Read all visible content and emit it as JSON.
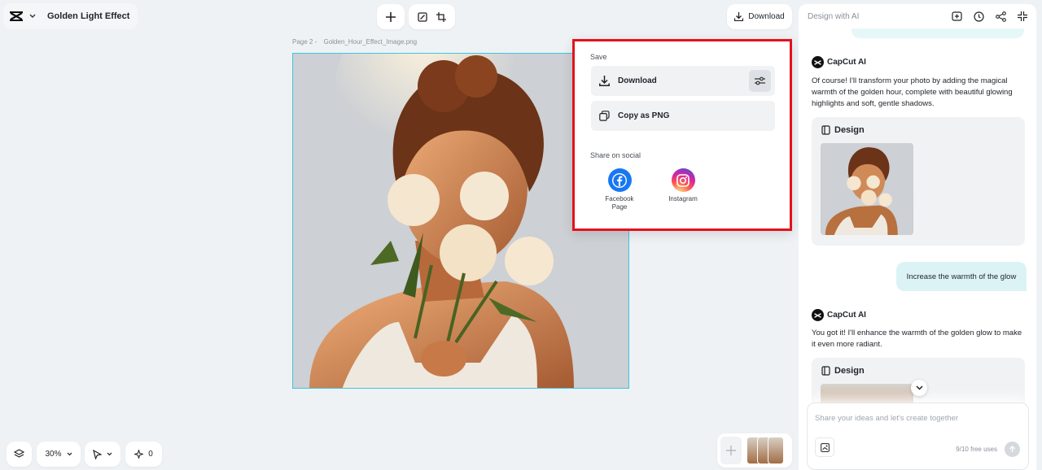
{
  "header": {
    "title": "Golden Light Effect",
    "download_label": "Download"
  },
  "canvas": {
    "page_label": "Page 2 -",
    "file_name": "Golden_Hour_Effect_Image.png"
  },
  "download_menu": {
    "save_heading": "Save",
    "download_label": "Download",
    "copy_label": "Copy as PNG",
    "share_heading": "Share on social",
    "social": [
      {
        "label_line1": "Facebook",
        "label_line2": "Page",
        "icon": "facebook-icon",
        "color": "#1877f2"
      },
      {
        "label_line1": "Instagram",
        "label_line2": "",
        "icon": "instagram-icon",
        "color": "#d62976"
      }
    ]
  },
  "chat": {
    "title": "Design with AI",
    "ai_name": "CapCut AI",
    "messages": [
      {
        "role": "ai",
        "text": "Of course! I'll transform your photo by adding the magical warmth of the golden hour, complete with beautiful glowing highlights and soft, gentle shadows.",
        "card_label": "Design"
      },
      {
        "role": "user",
        "text": "Increase the warmth of the glow"
      },
      {
        "role": "ai",
        "text": "You got it! I'll enhance the warmth of the golden glow to make it even more radiant.",
        "card_label": "Design"
      }
    ],
    "input_placeholder": "Share your ideas and let's create together",
    "usage": "9/10 free uses"
  },
  "bottom_bar": {
    "zoom": "30%",
    "magic_count": "0"
  },
  "colors": {
    "selection_border": "#3cc6e0",
    "highlight_box": "#e3121b",
    "user_bubble": "#dcf3f5"
  }
}
